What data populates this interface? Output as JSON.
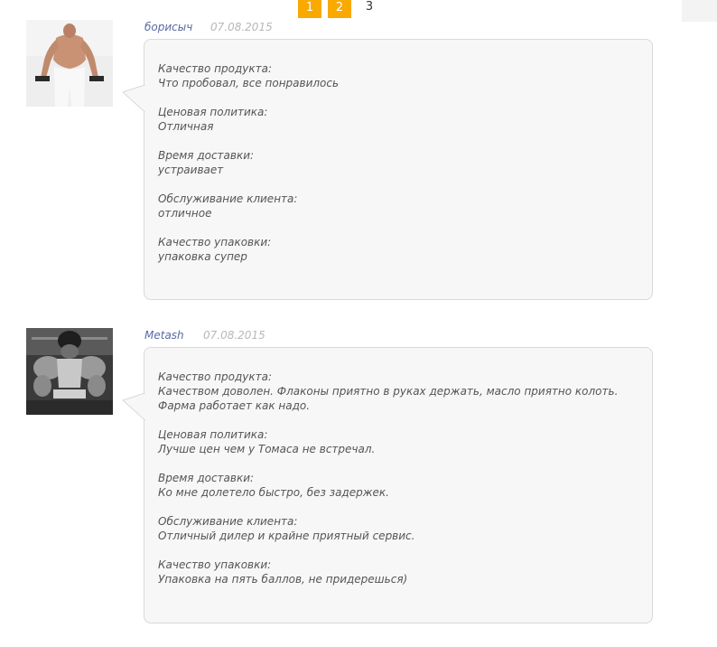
{
  "pagination": {
    "pages": [
      "1",
      "2",
      "3"
    ],
    "current": "3"
  },
  "reviews": [
    {
      "author": "борисыч",
      "date": "07.08.2015",
      "fields": [
        {
          "label": "Качество продукта:",
          "value": "Что пробовал, все понравилось"
        },
        {
          "label": "Ценовая политика:",
          "value": "Отличная"
        },
        {
          "label": "Время доставки:",
          "value": "устраивает"
        },
        {
          "label": "Обслуживание клиента:",
          "value": "отличное"
        },
        {
          "label": "Качество упаковки:",
          "value": "упаковка супер"
        }
      ]
    },
    {
      "author": "Metash",
      "date": "07.08.2015",
      "fields": [
        {
          "label": "Качество продукта:",
          "value": "Качеством доволен. Флаконы приятно в руках держать, масло приятно колоть. Фарма работает как надо."
        },
        {
          "label": "Ценовая политика:",
          "value": "Лучше цен чем у Томаса не встречал."
        },
        {
          "label": "Время доставки:",
          "value": "Ко мне долетело быстро, без задержек."
        },
        {
          "label": "Обслуживание клиента:",
          "value": "Отличный дилер и крайне приятный сервис."
        },
        {
          "label": "Качество упаковки:",
          "value": "Упаковка на пять баллов, не придерешься)"
        }
      ]
    }
  ],
  "colors": {
    "page_button": "#f9a900",
    "author": "#5b6aa5",
    "date": "#b8b8b8",
    "bubble_bg": "#f7f7f7",
    "bubble_border": "#d9d9d9"
  }
}
